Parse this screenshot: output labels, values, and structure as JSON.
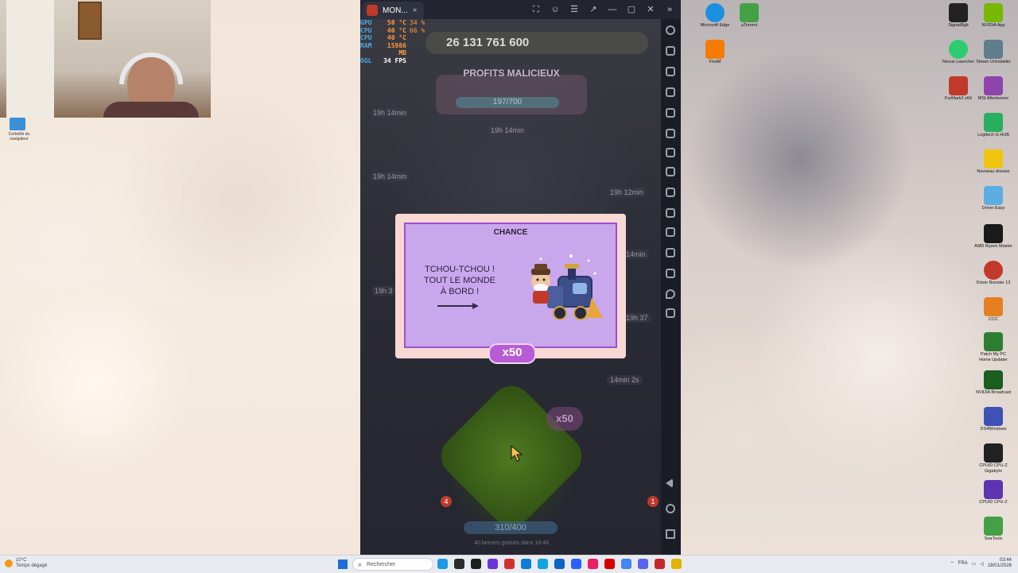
{
  "webcam": {},
  "emulator": {
    "tab_title": "MON...",
    "tab_close": "×",
    "controls": [
      "⛶",
      "☺",
      "☰",
      "↗",
      "—",
      "▢",
      "✕",
      "»"
    ]
  },
  "overlay": {
    "rows": [
      {
        "label": "GPU",
        "value": "50 °C",
        "extra": "34 %"
      },
      {
        "label": "CPU",
        "value": "40 °C",
        "extra": "66 %"
      },
      {
        "label": "CPU",
        "value": "40 °C",
        "extra": ""
      },
      {
        "label": "RAM",
        "value": "15986 MB",
        "extra": ""
      },
      {
        "label": "OGL",
        "value": "34 FPS",
        "extra": ""
      }
    ]
  },
  "game": {
    "money": "26 131 761 600",
    "banner_title": "PROFITS MALICIEUX",
    "progress": "197/700",
    "timers": [
      "19h 14min",
      "19h 14min",
      "19h 14min",
      "19h 12min",
      "19h 3",
      "19h 37",
      "14min 2s",
      "14min"
    ],
    "dice_multiplier": "x50",
    "bottom_progress": "310/400",
    "bottom_sub": "40 lancers gratuits dans 18:48",
    "badges": [
      "4",
      "1"
    ]
  },
  "chance": {
    "title": "CHANCE",
    "line1": "TCHOU-TCHOU !",
    "line2": "TOUT LE MONDE",
    "line3": "À BORD !",
    "multiplier": "x50"
  },
  "desktop_icons_right": [
    {
      "label": "SignalRgb",
      "color": "#222222"
    },
    {
      "label": "NVIDIA App",
      "color": "#76b900"
    },
    {
      "label": "Microsoft Edge",
      "color": "#1d8fe0"
    },
    {
      "label": "µTorrent",
      "color": "#43a047"
    },
    {
      "label": "FiveM",
      "color": "#f57c00"
    },
    {
      "label": "Nexus Launcher",
      "color": "#2ecc71"
    },
    {
      "label": "Steam Uninstaller",
      "color": "#607d8b"
    },
    {
      "label": "FurMark2 x64",
      "color": "#c0392b"
    },
    {
      "label": "MSI Afterburner",
      "color": "#8e44ad"
    },
    {
      "label": "Logitech G HUB",
      "color": "#27ae60"
    },
    {
      "label": "Nouveau dossier",
      "color": "#f1c40f"
    },
    {
      "label": "Driver Easy",
      "color": "#5dade2"
    },
    {
      "label": "AMD Ryzen Master",
      "color": "#1a1a1a"
    },
    {
      "label": "Driver Booster 13",
      "color": "#c0392b"
    },
    {
      "label": "CCC",
      "color": "#e67e22"
    },
    {
      "label": "Patch My PC Home Updater",
      "color": "#2e7d32"
    },
    {
      "label": "NVIDIA Broadcast",
      "color": "#1b5e20"
    },
    {
      "label": "DS4Windows",
      "color": "#3f51b5"
    },
    {
      "label": "CPUID CPU-Z Gigabyte",
      "color": "#212121"
    },
    {
      "label": "CPUID CPU-Z",
      "color": "#5e35b1"
    },
    {
      "label": "SeaTools",
      "color": "#43a047"
    }
  ],
  "desktop_icon_left": {
    "label": "Corbeille du navigateur"
  },
  "taskbar": {
    "weather_temp": "10°C",
    "weather_desc": "Temps dégagé",
    "search_placeholder": "Rechercher",
    "lang": "FRA",
    "time": "03:44",
    "date": "18/01/2026",
    "apps": [
      "#1a9be6",
      "#2b2b2b",
      "#1f1f1f",
      "#6a35d6",
      "#d32f2f",
      "#0f7bd6",
      "#11a4e0",
      "#0b63c5",
      "#2962ff",
      "#e91e63",
      "#d50000",
      "#4285f4",
      "#5865f2",
      "#c62828",
      "#e0b400"
    ]
  }
}
